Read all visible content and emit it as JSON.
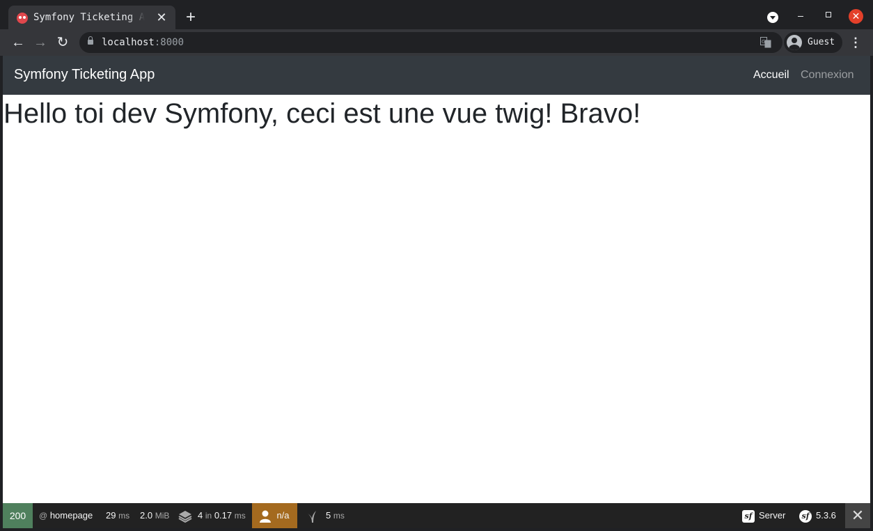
{
  "browser": {
    "tab": {
      "title": "Symfony Ticketing App",
      "close_glyph": "✕"
    },
    "new_tab_glyph": "+",
    "url_host": "localhost",
    "url_port": ":8000",
    "profile_name": "Guest",
    "kebab_glyph": "⋮",
    "back_glyph": "←",
    "forward_glyph": "→",
    "reload_glyph": "↻",
    "close_glyph": "✕"
  },
  "page": {
    "navbar": {
      "brand": "Symfony Ticketing App",
      "links": [
        {
          "label": "Accueil",
          "state": "active"
        },
        {
          "label": "Connexion",
          "state": "inactive"
        }
      ]
    },
    "heading": "Hello toi dev Symfony, ceci est une vue twig! Bravo!"
  },
  "debug_toolbar": {
    "status_code": "200",
    "route_prefix": "@",
    "route": "homepage",
    "time_value": "29",
    "time_unit": "ms",
    "memory_value": "2.0",
    "memory_unit": "MiB",
    "templates_count": "4",
    "templates_in": "in",
    "templates_time": "0.17",
    "templates_unit": "ms",
    "user": "n/a",
    "twig_value": "5",
    "twig_unit": "ms",
    "server_label": "Server",
    "symfony_version": "5.3.6",
    "logo_glyph": "sf",
    "close_glyph": "✕",
    "colors": {
      "status_ok": "#4f805d",
      "user_warning": "#a46a1f",
      "bar": "#222222"
    }
  }
}
